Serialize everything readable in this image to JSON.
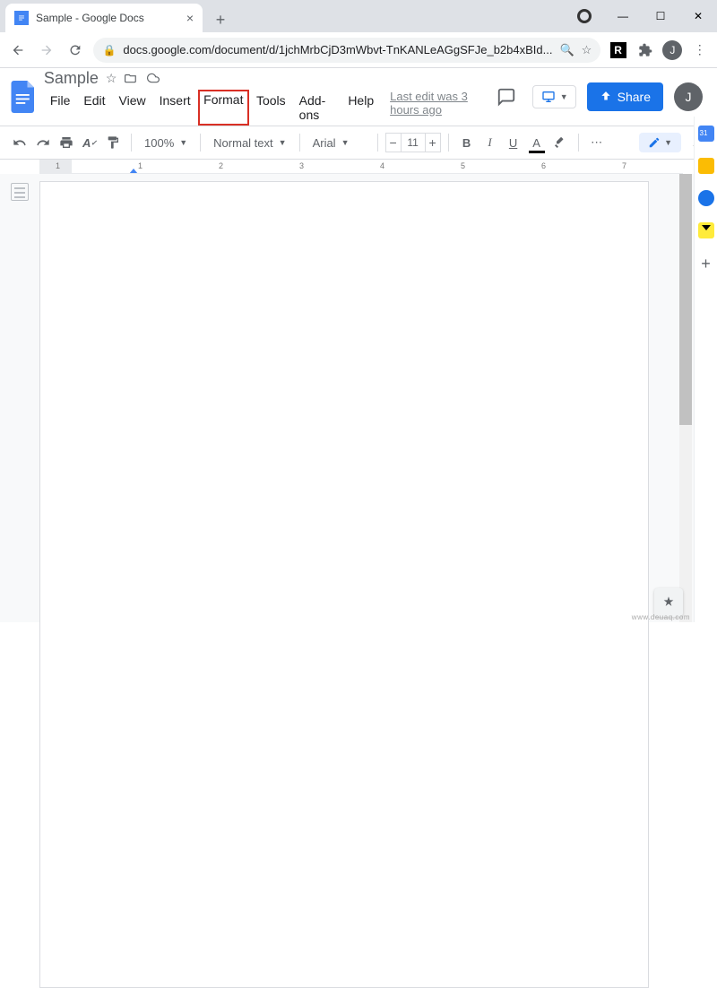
{
  "browser": {
    "tab_title": "Sample - Google Docs",
    "url": "docs.google.com/document/d/1jchMrbCjD3mWbvt-TnKANLeAGgSFJe_b2b4xBId..."
  },
  "doc": {
    "title": "Sample",
    "menu": {
      "file": "File",
      "edit": "Edit",
      "view": "View",
      "insert": "Insert",
      "format": "Format",
      "tools": "Tools",
      "addons": "Add-ons",
      "help": "Help"
    },
    "last_edit": "Last edit was 3 hours ago",
    "share_label": "Share",
    "avatar_initial": "J"
  },
  "toolbar": {
    "zoom": "100%",
    "style": "Normal text",
    "font": "Arial",
    "font_size": "11"
  },
  "ruler": {
    "nums": [
      "1",
      "1",
      "2",
      "3",
      "4",
      "5",
      "6",
      "7"
    ]
  },
  "watermark": "www.deuaq.com"
}
